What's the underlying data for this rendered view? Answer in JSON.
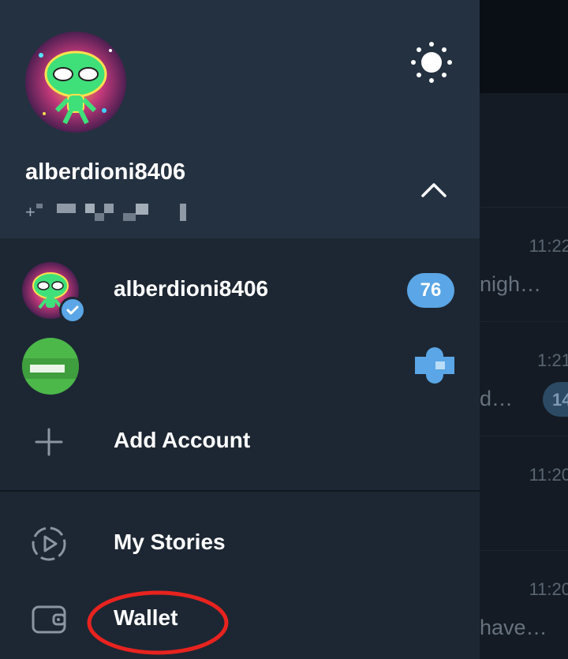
{
  "header": {
    "username": "alberdioni8406",
    "phone_display": "+"
  },
  "accounts": [
    {
      "name": "alberdioni8406",
      "badge": "76",
      "verified": true
    },
    {
      "name": "",
      "badge": "",
      "censored": true
    }
  ],
  "menu": {
    "add_account": "Add Account",
    "my_stories": "My Stories",
    "wallet": "Wallet"
  },
  "background_chats": [
    {
      "time": "11:22",
      "snippet": "nigh…"
    },
    {
      "time": "1:21",
      "snippet": "d…",
      "badge": "14"
    },
    {
      "time": "11:20",
      "snippet": ""
    },
    {
      "time": "11:20",
      "snippet": "have…"
    }
  ],
  "colors": {
    "drawer_bg": "#1d2733",
    "header_bg": "#243140",
    "badge_blue": "#5aa6e6",
    "annotation_red": "#e8231f"
  },
  "icons": [
    "sun-icon",
    "chevron-up-icon",
    "verified-check-icon",
    "plus-icon",
    "stories-icon",
    "wallet-icon"
  ]
}
